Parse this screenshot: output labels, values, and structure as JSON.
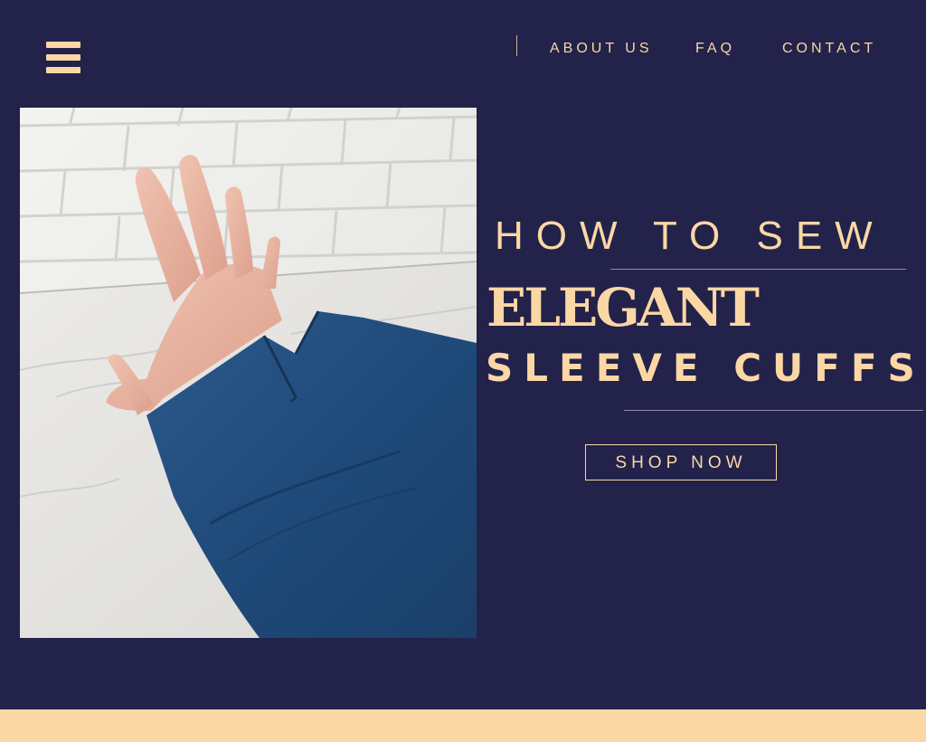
{
  "header": {
    "menu_icon": "hamburger-menu-icon",
    "nav": {
      "about": "ABOUT US",
      "faq": "FAQ",
      "contact": "CONTACT"
    }
  },
  "hero": {
    "image_alt": "",
    "headline_line1": "HOW TO SEW",
    "headline_line2": "ELEGANT",
    "headline_line3": "SLEEVE CUFFS",
    "cta_label": "SHOP NOW"
  },
  "colors": {
    "background": "#23224a",
    "accent": "#fbd7a6",
    "footer_band": "#fbd7a6"
  }
}
